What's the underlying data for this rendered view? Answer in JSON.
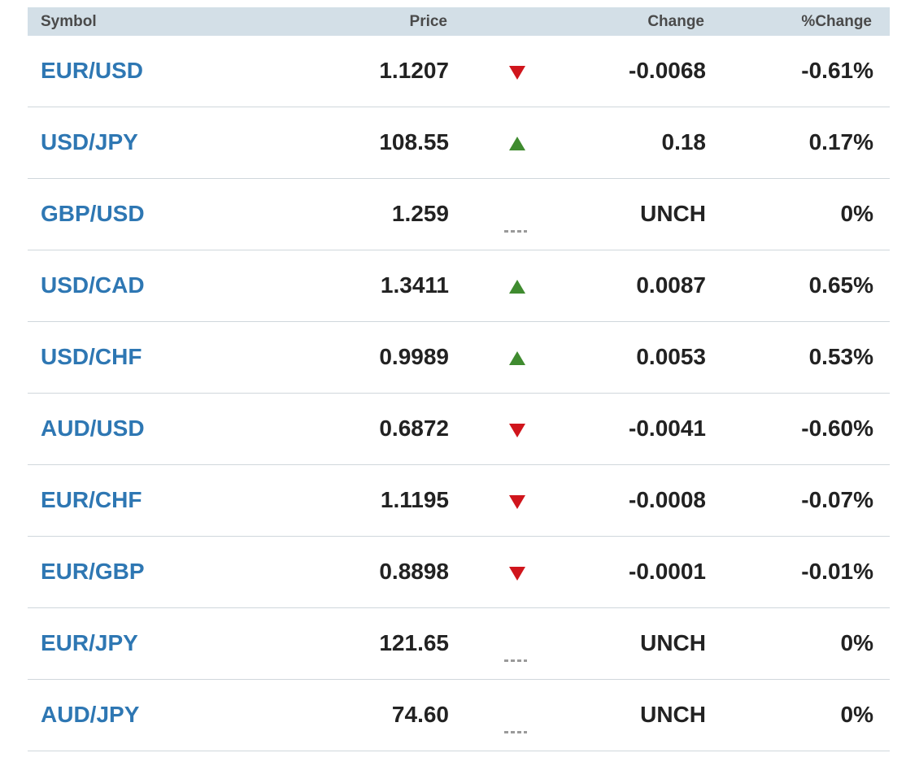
{
  "header": {
    "symbol": "Symbol",
    "price": "Price",
    "change": "Change",
    "pct_change": "%Change"
  },
  "rows": [
    {
      "symbol": "EUR/USD",
      "price": "1.1207",
      "direction": "down",
      "change": "-0.0068",
      "pct": "-0.61%"
    },
    {
      "symbol": "USD/JPY",
      "price": "108.55",
      "direction": "up",
      "change": "0.18",
      "pct": "0.17%"
    },
    {
      "symbol": "GBP/USD",
      "price": "1.259",
      "direction": "unch",
      "change": "UNCH",
      "pct": "0%"
    },
    {
      "symbol": "USD/CAD",
      "price": "1.3411",
      "direction": "up",
      "change": "0.0087",
      "pct": "0.65%"
    },
    {
      "symbol": "USD/CHF",
      "price": "0.9989",
      "direction": "up",
      "change": "0.0053",
      "pct": "0.53%"
    },
    {
      "symbol": "AUD/USD",
      "price": "0.6872",
      "direction": "down",
      "change": "-0.0041",
      "pct": "-0.60%"
    },
    {
      "symbol": "EUR/CHF",
      "price": "1.1195",
      "direction": "down",
      "change": "-0.0008",
      "pct": "-0.07%"
    },
    {
      "symbol": "EUR/GBP",
      "price": "0.8898",
      "direction": "down",
      "change": "-0.0001",
      "pct": "-0.01%"
    },
    {
      "symbol": "EUR/JPY",
      "price": "121.65",
      "direction": "unch",
      "change": "UNCH",
      "pct": "0%"
    },
    {
      "symbol": "AUD/JPY",
      "price": "74.60",
      "direction": "unch",
      "change": "UNCH",
      "pct": "0%"
    }
  ],
  "colors": {
    "symbol_link": "#2e77b3",
    "up": "#3f8b2f",
    "down": "#d0151c",
    "header_bg": "#d3dfe7"
  },
  "icons": {
    "up": "arrow-up-icon",
    "down": "arrow-down-icon",
    "unch": "unchanged-dash-icon"
  }
}
